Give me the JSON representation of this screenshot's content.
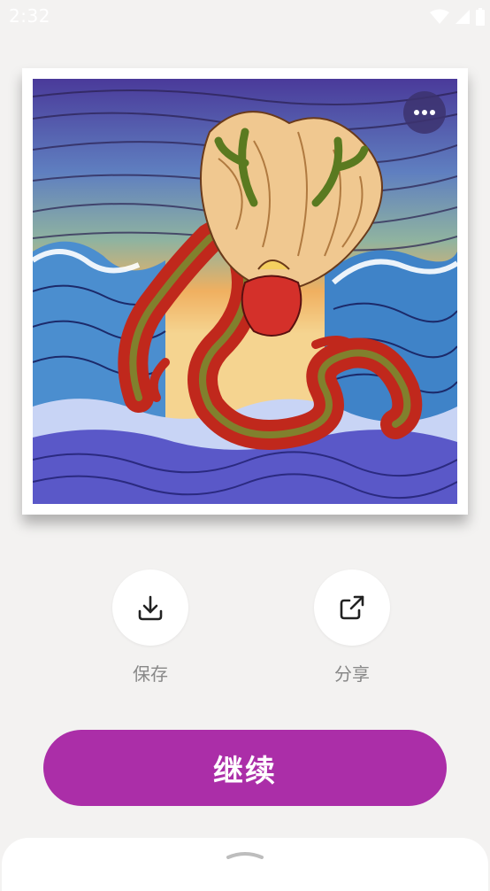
{
  "status_bar": {
    "time": "2:32"
  },
  "artwork": {
    "subject": "dragon-coloring-artwork"
  },
  "more_button": {
    "icon": "more-horizontal-icon"
  },
  "actions": [
    {
      "label": "保存",
      "icon": "download-icon"
    },
    {
      "label": "分享",
      "icon": "share-icon"
    }
  ],
  "continue_button": {
    "label": "继续"
  },
  "colors": {
    "accent": "#ab2ea8",
    "background": "#f3f2f1"
  }
}
